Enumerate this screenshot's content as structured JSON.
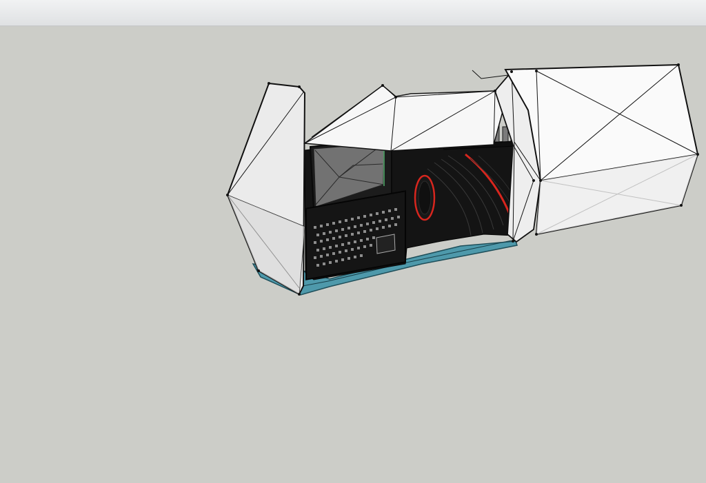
{
  "window": {
    "title": ""
  },
  "viewport": {
    "background": "#cccdc8",
    "model": {
      "shell_color": "#ffffff",
      "panel_color": "#e8e8e8",
      "edge_color": "#111111",
      "base_color": "#4e99ab",
      "interior_color": "#151515",
      "accent_color": "#d8261e",
      "glass_color": "#6f6f6f"
    }
  }
}
